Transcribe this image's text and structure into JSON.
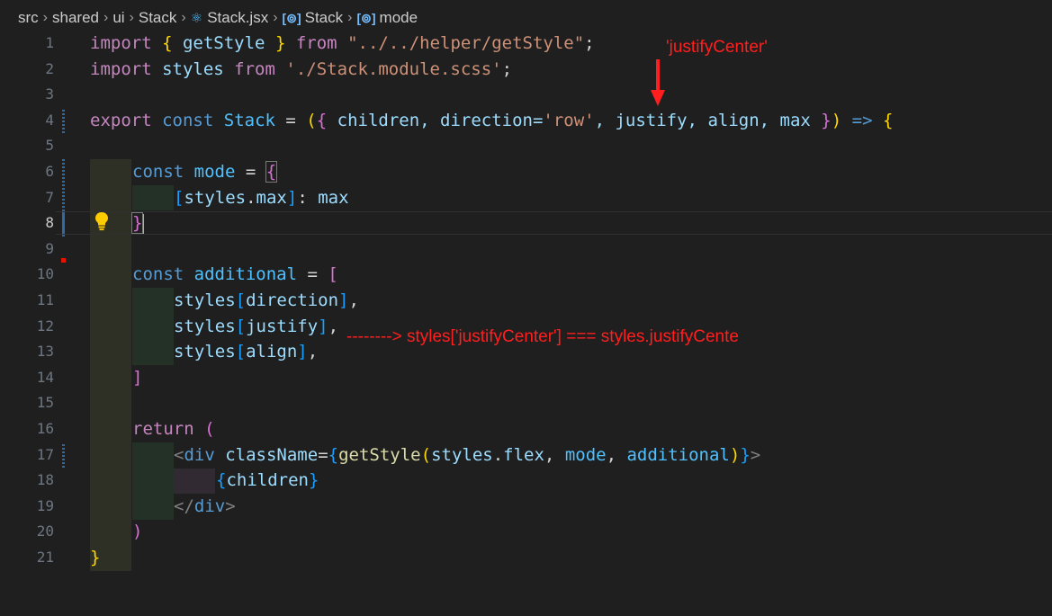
{
  "breadcrumb": {
    "items": [
      "src",
      "shared",
      "ui",
      "Stack",
      "Stack.jsx",
      "Stack",
      "mode"
    ],
    "separator": ">"
  },
  "editor": {
    "active_line": 8,
    "lines": [
      {
        "n": "1"
      },
      {
        "n": "2"
      },
      {
        "n": "3"
      },
      {
        "n": "4"
      },
      {
        "n": "5"
      },
      {
        "n": "6"
      },
      {
        "n": "7"
      },
      {
        "n": "8"
      },
      {
        "n": "9"
      },
      {
        "n": "10"
      },
      {
        "n": "11"
      },
      {
        "n": "12"
      },
      {
        "n": "13"
      },
      {
        "n": "14"
      },
      {
        "n": "15"
      },
      {
        "n": "16"
      },
      {
        "n": "17"
      },
      {
        "n": "18"
      },
      {
        "n": "19"
      },
      {
        "n": "20"
      },
      {
        "n": "21"
      }
    ],
    "tokens": {
      "l1": [
        "import",
        " ",
        "{",
        " getStyle ",
        "}",
        " ",
        "from",
        " ",
        "\"../../helper/getStyle\"",
        ";"
      ],
      "l2": [
        "import",
        " styles ",
        "from",
        " ",
        "'./Stack.module.scss'",
        ";"
      ],
      "l4": [
        "export",
        " ",
        "const",
        " ",
        "Stack",
        " = ",
        "(",
        "{",
        " children, direction=",
        "'row'",
        ", justify, align, max ",
        "}",
        ")",
        " ",
        "=>",
        " ",
        "{"
      ],
      "l6": [
        "const",
        " ",
        "mode",
        " = ",
        "{"
      ],
      "l7": [
        "[",
        "styles",
        ".",
        "max",
        "]",
        ": ",
        "max"
      ],
      "l8": [
        "}"
      ],
      "l10": [
        "const",
        " ",
        "additional",
        " = ",
        "["
      ],
      "l11": [
        "styles",
        "[",
        "direction",
        "]",
        ","
      ],
      "l12": [
        "styles",
        "[",
        "justify",
        "]",
        ","
      ],
      "l13": [
        "styles",
        "[",
        "align",
        "]",
        ","
      ],
      "l14": [
        "]"
      ],
      "l16": [
        "return",
        " ",
        "("
      ],
      "l17": [
        "<",
        "div",
        " ",
        "className",
        "=",
        "{",
        "getStyle",
        "(",
        "styles",
        ".",
        "flex",
        ", ",
        "mode",
        ", ",
        "additional",
        ")",
        "}",
        ">"
      ],
      "l18": [
        "{",
        "children",
        "}"
      ],
      "l19": [
        "</",
        "div",
        ">"
      ],
      "l20": [
        ")"
      ],
      "l21": [
        "}"
      ]
    }
  },
  "annotations": {
    "top_label": "'justifyCenter'",
    "line_note": "--------> styles['justifyCenter'] === styles.justifyCente",
    "color": "#ff1f1f"
  },
  "icons": {
    "react": "react-icon",
    "symbol": "symbol-variable-icon",
    "bulb": "lightbulb-icon"
  }
}
